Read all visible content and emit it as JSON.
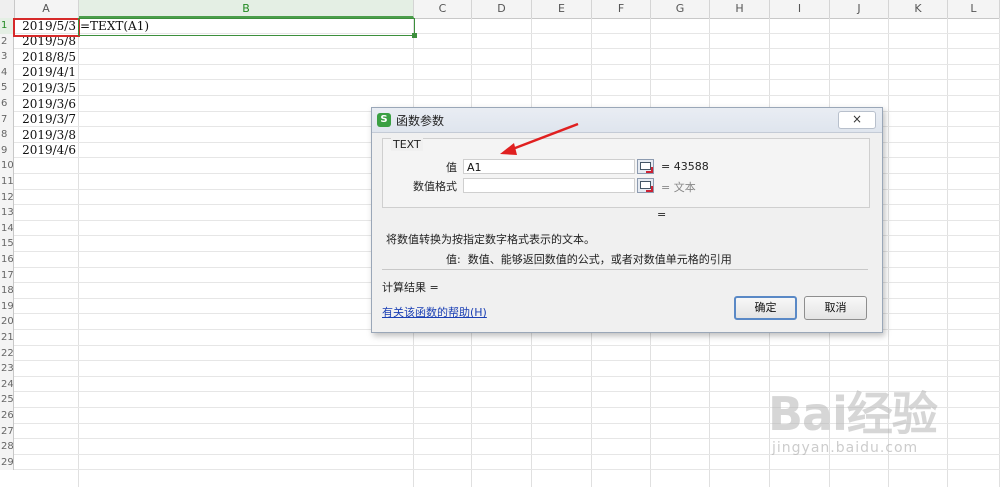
{
  "sheet": {
    "columns": [
      "A",
      "B",
      "C",
      "D",
      "E",
      "F",
      "G",
      "H",
      "I",
      "J",
      "K",
      "L"
    ],
    "rows": [
      "1",
      "2",
      "3",
      "4",
      "5",
      "6",
      "7",
      "8",
      "9",
      "10",
      "11",
      "12",
      "13",
      "14",
      "15",
      "16",
      "17",
      "18",
      "19",
      "20",
      "21",
      "22",
      "23",
      "24",
      "25",
      "26",
      "27",
      "28",
      "29"
    ],
    "column_a_values": [
      "2019/5/3",
      "2019/5/8",
      "2018/8/5",
      "2019/4/1",
      "2019/3/5",
      "2019/3/6",
      "2019/3/7",
      "2019/3/8",
      "2019/4/6"
    ],
    "b1_formula": "=TEXT(A1)"
  },
  "dialog": {
    "title": "函数参数",
    "close_label": "×",
    "function_name": "TEXT",
    "args": [
      {
        "label": "值",
        "value": "A1",
        "result": "= 43588"
      },
      {
        "label": "数值格式",
        "value": "",
        "result": "= 文本"
      }
    ],
    "overall_result_eq": "=",
    "description": "将数值转换为按指定数字格式表示的文本。",
    "param_desc_label": "值:",
    "param_desc_text": "数值、能够返回数值的公式，或者对数值单元格的引用",
    "result_label": "计算结果 =",
    "help_link": "有关该函数的帮助(H)",
    "ok_label": "确定",
    "cancel_label": "取消"
  },
  "watermark": {
    "logo": "Bai经验",
    "url": "jingyan.baidu.com"
  },
  "colors": {
    "selection_red": "#d62a2a",
    "active_green": "#3c8f3c",
    "arrow_red": "#e02020"
  }
}
